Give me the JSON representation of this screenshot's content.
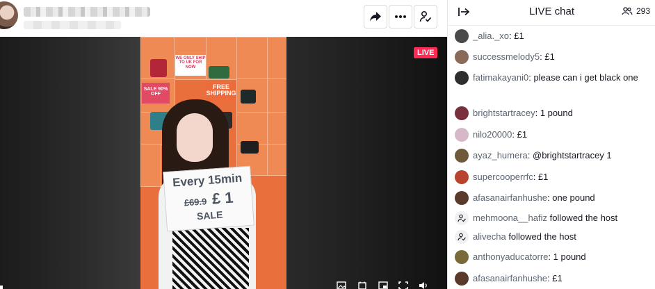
{
  "stream": {
    "live_badge": "LIVE",
    "card": {
      "line1": "Every 15min",
      "old_price": "£69.9",
      "new_price": "£ 1",
      "line3": "SALE"
    },
    "shelf_signs": {
      "only_ship": "WE ONLY SHIP TO UK FOR NOW",
      "sale": "SALE 90% OFF",
      "free_shipping": "FREE SHIPPING"
    },
    "toolbar_icons": [
      "share-icon",
      "more-icon",
      "report-icon"
    ]
  },
  "chat": {
    "title": "LIVE chat",
    "viewer_count": "293",
    "messages": [
      {
        "user": "_alia._xo",
        "text": ": £1",
        "avatar_color": "#4a4a4a"
      },
      {
        "user": "successmelody5",
        "text": ": £1",
        "avatar_color": "#8a6a58"
      },
      {
        "user": "fatimakayani0",
        "text": ": please can i get black one",
        "avatar_color": "#2e2e2e"
      },
      {
        "user": "brightstartracey",
        "text": ": 1 pound",
        "avatar_color": "#7a2f3c"
      },
      {
        "user": "nilo20000",
        "text": ": £1",
        "avatar_color": "#d6b8c8"
      },
      {
        "user": "ayaz_humera",
        "text": ": @brightstartracey 1",
        "avatar_color": "#6e5a3a"
      },
      {
        "user": "supercooperrfc",
        "text": ": £1",
        "avatar_color": "#b8432f"
      },
      {
        "user": "afasanairfanhushe",
        "text": ": one pound",
        "avatar_color": "#5a3a2a"
      },
      {
        "user": "mehmoona__hafiz",
        "text": " followed the host",
        "system": true
      },
      {
        "user": "alivecha",
        "text": " followed the host",
        "system": true
      },
      {
        "user": "anthonyaducatorre",
        "text": ": 1 pound",
        "avatar_color": "#7a6a3a"
      },
      {
        "user": "afasanairfanhushe",
        "text": ": £1",
        "avatar_color": "#5a3a2a"
      }
    ]
  }
}
